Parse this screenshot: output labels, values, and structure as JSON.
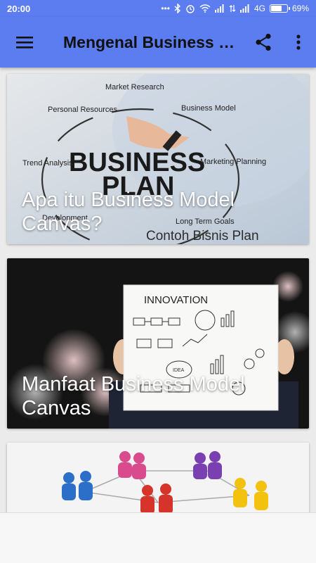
{
  "status_bar": {
    "time": "20:00",
    "network": "4G",
    "battery_percent": "69%",
    "battery_level": 0.69
  },
  "app_bar": {
    "title": "Mengenal Business Model Canvas",
    "menu_icon": "hamburger-menu-icon",
    "share_icon": "share-icon",
    "more_icon": "more-vert-icon",
    "color": "#5b7df0"
  },
  "articles": [
    {
      "title": "Apa itu Business Model Canvas?",
      "image": {
        "heading_line1": "BUSINESS",
        "heading_line2": "PLAN",
        "nodes": [
          "Market Research",
          "Business Model",
          "Marketing Planning",
          "Long Term Goals",
          "Personal Resources",
          "Trend Analysis",
          "Development"
        ],
        "watermark": "Contoh Bisnis Plan"
      }
    },
    {
      "title": "Manfaat Business Model Canvas",
      "image": {
        "board_heading": "INNOVATION",
        "board_label": "IDEA"
      }
    },
    {
      "title": "",
      "image": {}
    }
  ]
}
